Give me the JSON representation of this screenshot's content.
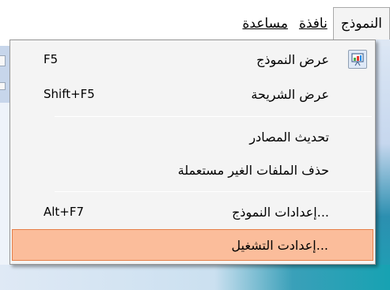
{
  "menubar": {
    "items": [
      {
        "label": "النموذج",
        "active": true
      },
      {
        "label": "نافذة",
        "active": false
      },
      {
        "label": "مساعدة",
        "active": false
      }
    ]
  },
  "dropdown": {
    "items": [
      {
        "label": "عرض النموذج",
        "shortcut": "F5",
        "icon": "presentation-icon"
      },
      {
        "label": "عرض الشريحة",
        "shortcut": "Shift+F5"
      },
      {
        "label": "تحديث المصادر",
        "shortcut": ""
      },
      {
        "label": "حذف الملفات الغير مستعملة",
        "shortcut": ""
      },
      {
        "label": "...إعدادات النموذج",
        "shortcut": "Alt+F7"
      },
      {
        "label": "...إعدادت التشغيل",
        "shortcut": "",
        "highlighted": true
      }
    ]
  },
  "colors": {
    "highlight_fill": "#fbbd9b",
    "highlight_border": "#e67f48",
    "menu_bg": "#f4f4f4"
  }
}
